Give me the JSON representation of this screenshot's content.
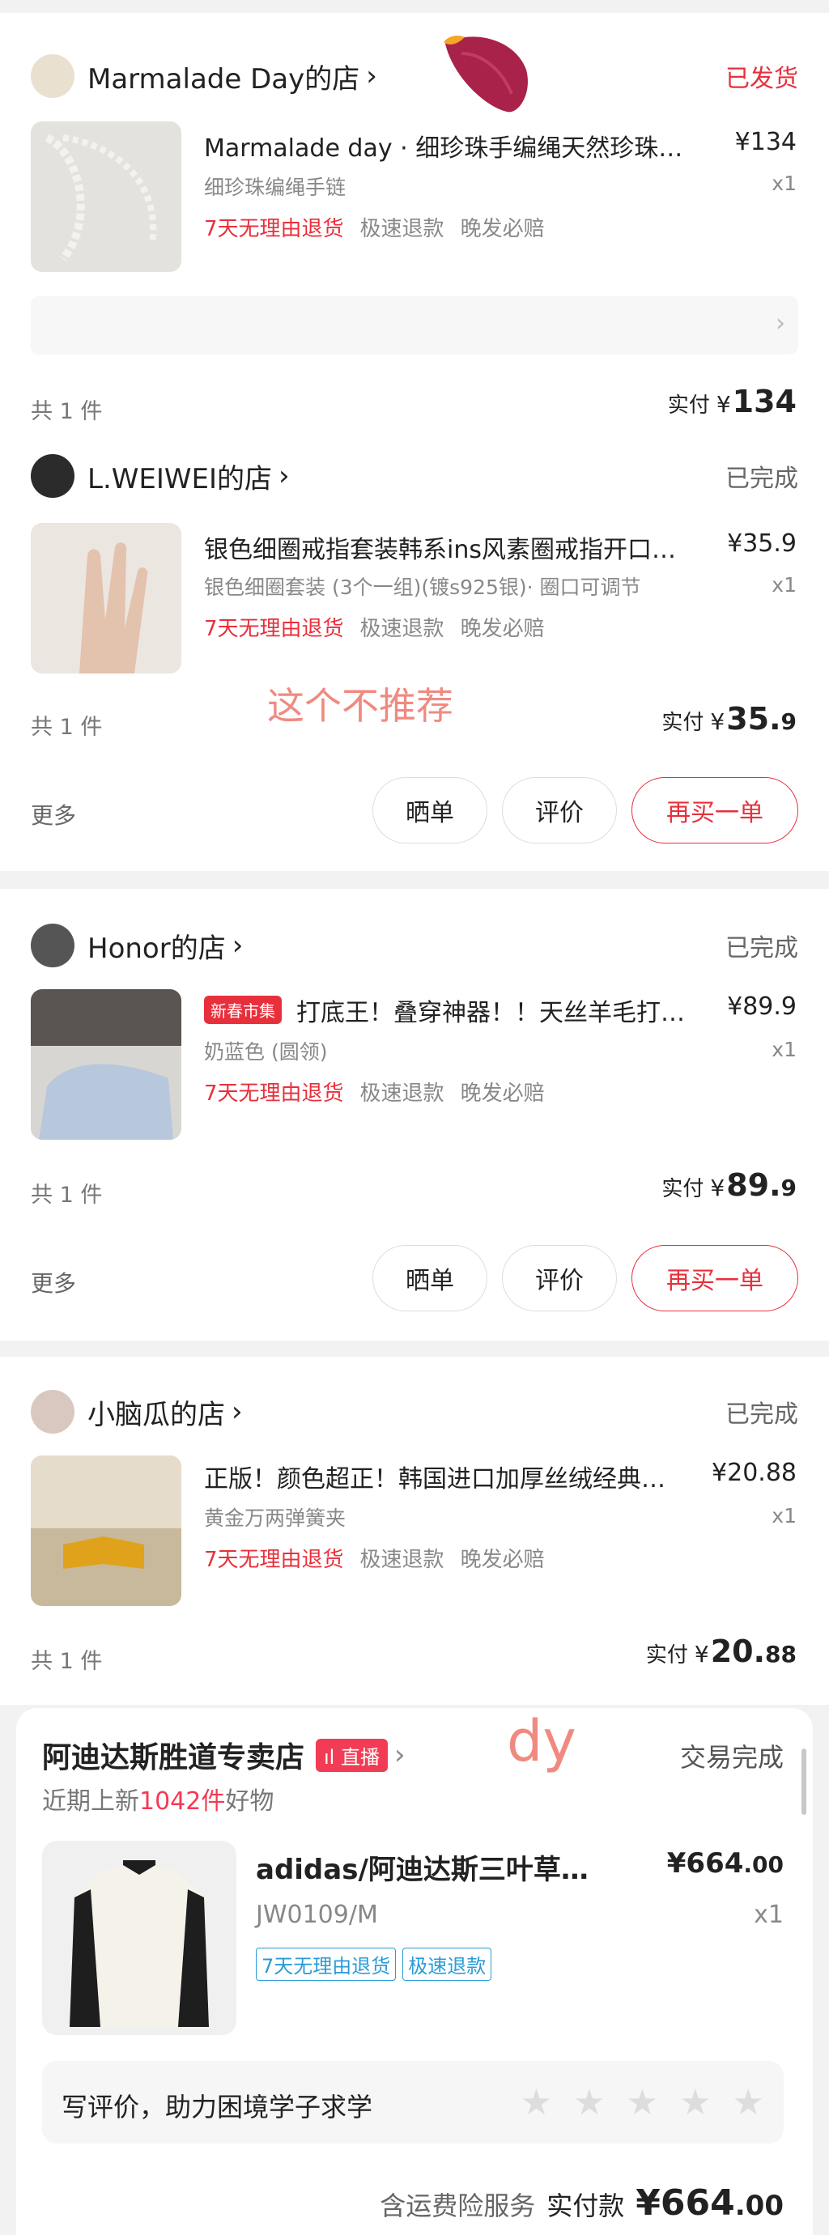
{
  "orders": [
    {
      "shop": "Marmalade Day的店",
      "status": "已发货",
      "title": "Marmalade day · 细珍珠手编绳天然珍珠…",
      "price": "¥134",
      "sku": "细珍珠编绳手链",
      "qty": "x1",
      "tags": [
        "7天无理由退货",
        "极速退款",
        "晚发必赔"
      ],
      "count": "共 1 件",
      "paid_label": "实付",
      "paid_int": "134",
      "paid_dec": ""
    },
    {
      "shop": "L.WEIWEI的店",
      "status": "已完成",
      "title": "银色细圈戒指套装韩系ins风素圈戒指开口…",
      "price": "¥35.9",
      "sku": "银色细圈套装 (3个一组)(镀s925银)· 圈口可调节",
      "qty": "x1",
      "tags": [
        "7天无理由退货",
        "极速退款",
        "晚发必赔"
      ],
      "count": "共 1 件",
      "paid_label": "实付",
      "paid_int": "35.",
      "paid_dec": "9",
      "annotation": "这个不推荐",
      "more": "更多",
      "buttons": [
        "晒单",
        "评价",
        "再买一单"
      ]
    },
    {
      "shop": "Honor的店",
      "status": "已完成",
      "badge": "新春市集",
      "title": "打底王！叠穿神器！！天丝羊毛打…",
      "price": "¥89.9",
      "sku": "奶蓝色 (圆领)",
      "qty": "x1",
      "tags": [
        "7天无理由退货",
        "极速退款",
        "晚发必赔"
      ],
      "count": "共 1 件",
      "paid_label": "实付",
      "paid_int": "89.",
      "paid_dec": "9",
      "more": "更多",
      "buttons": [
        "晒单",
        "评价",
        "再买一单"
      ]
    },
    {
      "shop": "小脑瓜的店",
      "status": "已完成",
      "title": "正版！颜色超正！韩国进口加厚丝绒经典…",
      "price": "¥20.88",
      "sku": "黄金万两弹簧夹",
      "qty": "x1",
      "tags": [
        "7天无理由退货",
        "极速退款",
        "晚发必赔"
      ],
      "count": "共 1 件",
      "paid_label": "实付",
      "paid_int": "20.",
      "paid_dec": "88"
    }
  ],
  "dy": {
    "shop": "阿迪达斯胜道专卖店",
    "live": "直播",
    "annotation": "dy",
    "status": "交易完成",
    "sub_prefix": "近期上新",
    "sub_count": "1042件",
    "sub_suffix": "好物",
    "title": "adidas/阿迪达斯三叶草…",
    "price_int": "¥664",
    "price_dec": ".00",
    "sku": "JW0109/M",
    "qty": "x1",
    "tags": [
      "7天无理由退货",
      "极速退款"
    ],
    "review_prompt": "写评价，助力困境学子求学",
    "insurance": "含运费险服务",
    "paid_label": "实付款",
    "paid_int": "¥664",
    "paid_dec": ".00"
  },
  "colors": {
    "accent": "#e8303c",
    "dy_tag": "#2a9bd8"
  }
}
